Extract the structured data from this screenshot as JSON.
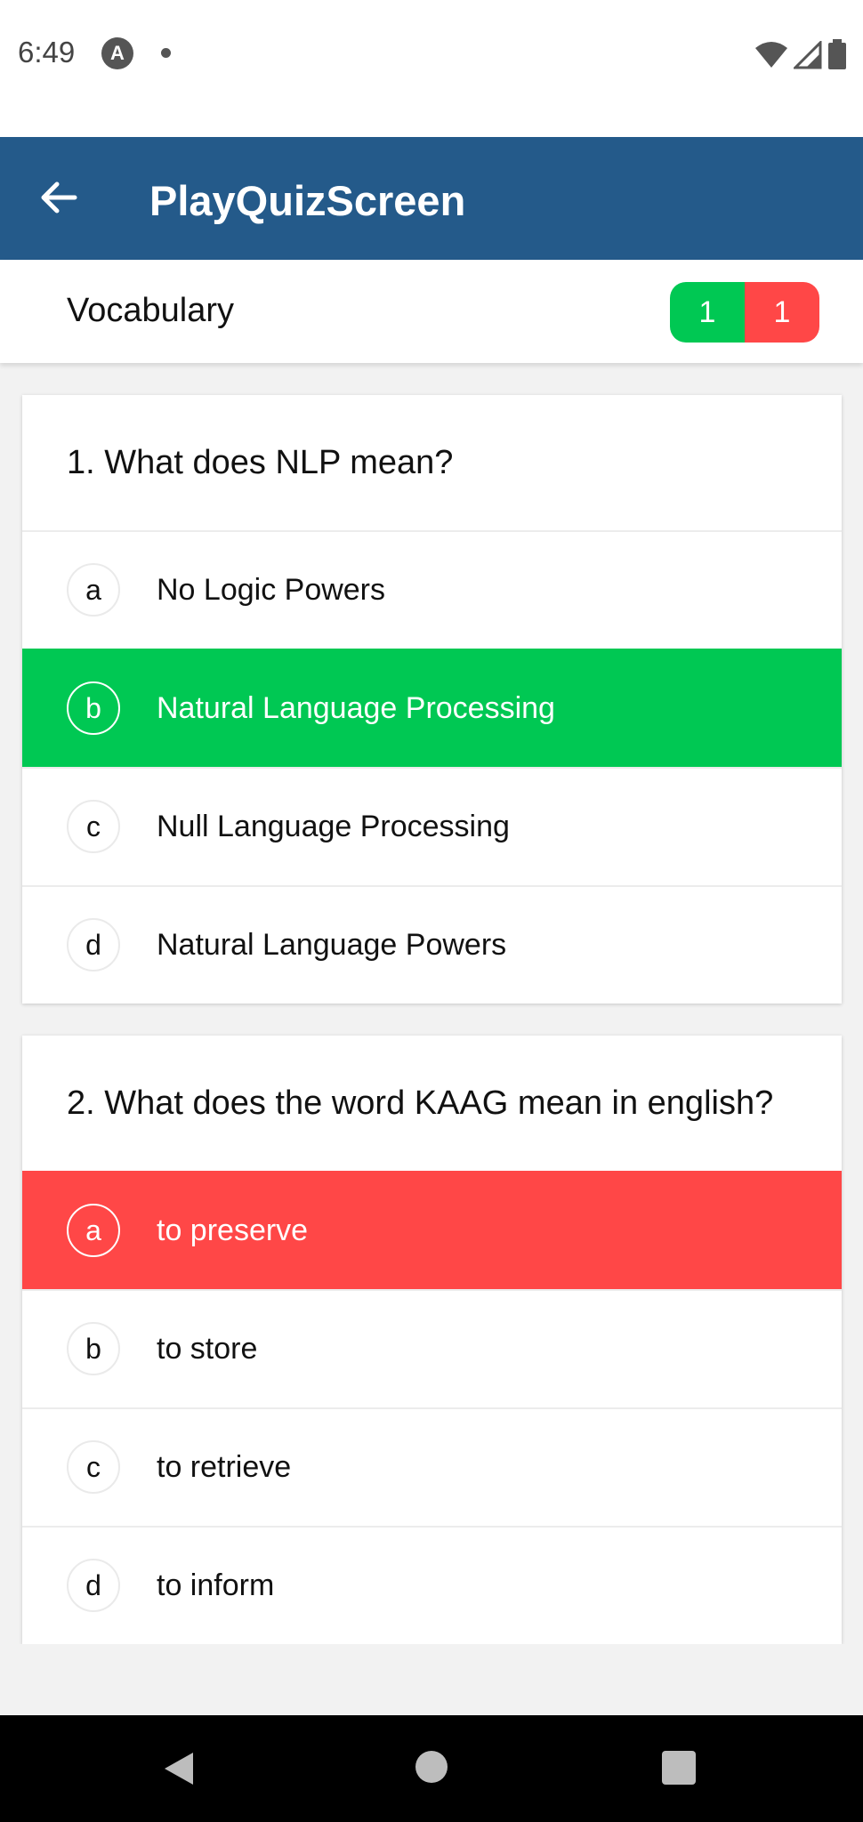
{
  "status_bar": {
    "time": "6:49",
    "app_icon_letter": "A",
    "icons": [
      "app-notification-icon",
      "dot-icon",
      "wifi-icon",
      "signal-icon",
      "battery-icon"
    ]
  },
  "app_bar": {
    "title": "PlayQuizScreen",
    "back_icon": "arrow-back-icon",
    "background_color": "#245a8a"
  },
  "quiz": {
    "category": "Vocabulary",
    "score": {
      "correct": "1",
      "wrong": "1"
    },
    "colors": {
      "correct": "#00c853",
      "wrong": "#ff4747"
    },
    "questions": [
      {
        "text": "1. What does NLP mean?",
        "options": [
          {
            "letter": "a",
            "text": "No Logic Powers",
            "state": "none"
          },
          {
            "letter": "b",
            "text": "Natural Language Processing",
            "state": "correct"
          },
          {
            "letter": "c",
            "text": "Null Language Processing",
            "state": "none"
          },
          {
            "letter": "d",
            "text": "Natural Language Powers",
            "state": "none"
          }
        ]
      },
      {
        "text": "2. What does the word KAAG mean in english?",
        "options": [
          {
            "letter": "a",
            "text": "to preserve",
            "state": "wrong"
          },
          {
            "letter": "b",
            "text": "to store",
            "state": "none"
          },
          {
            "letter": "c",
            "text": "to retrieve",
            "state": "none"
          },
          {
            "letter": "d",
            "text": "to inform",
            "state": "none"
          }
        ]
      }
    ]
  },
  "nav_bar": {
    "icons": [
      "nav-back-icon",
      "nav-home-icon",
      "nav-recents-icon"
    ]
  }
}
